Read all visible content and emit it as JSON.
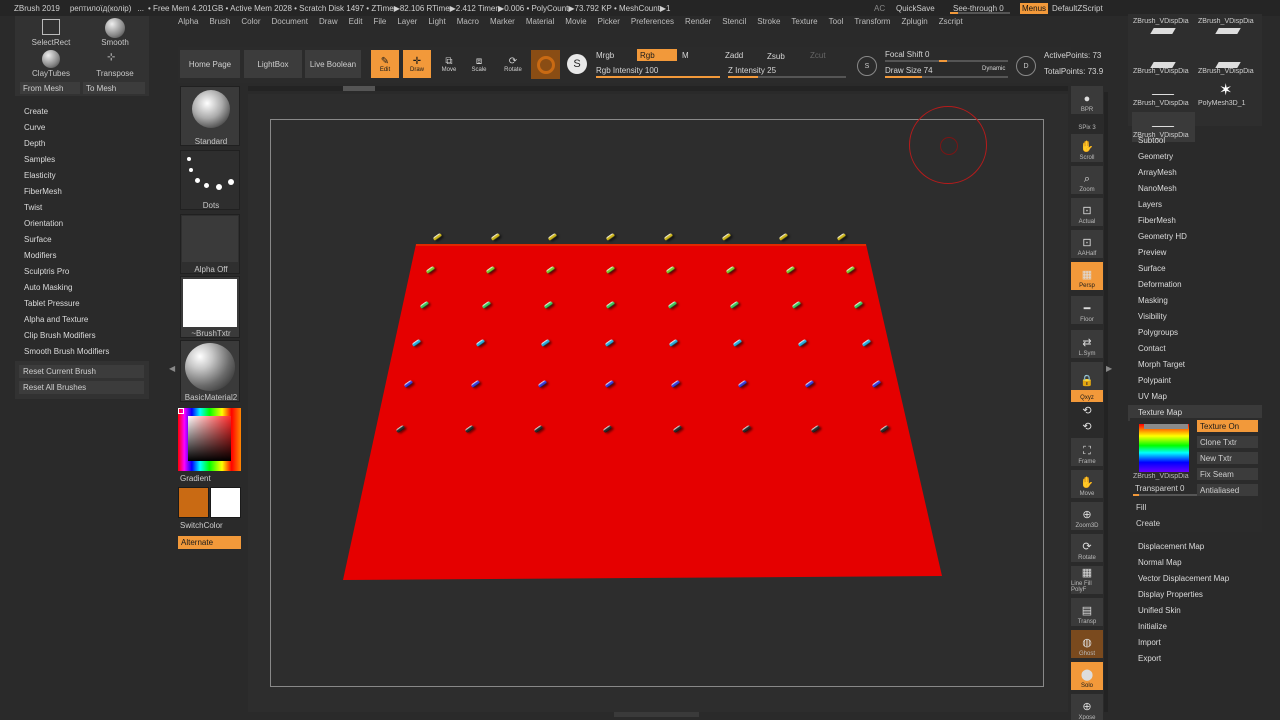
{
  "topbar": {
    "app": "ZBrush 2019",
    "doc": "рептилоїд(колір)",
    "sep": "...",
    "stats": "• Free Mem 4.201GB • Active Mem 2028 • Scratch Disk 1497 • ZTime▶82.106 RTime▶2.412 Timer▶0.006 • PolyCount▶73.792 KP • MeshCount▶1",
    "ac": "AC",
    "quicksave": "QuickSave",
    "seethrough": "See-through  0",
    "menus": "Menus",
    "script": "DefaultZScript"
  },
  "menubar": [
    "Alpha",
    "Brush",
    "Color",
    "Document",
    "Draw",
    "Edit",
    "File",
    "Layer",
    "Light",
    "Macro",
    "Marker",
    "Material",
    "Movie",
    "Picker",
    "Preferences",
    "Render",
    "Stencil",
    "Stroke",
    "Texture",
    "Tool",
    "Transform",
    "Zplugin",
    "Zscript"
  ],
  "left_palette": {
    "select_rect": "SelectRect",
    "smooth": "Smooth",
    "clay_tubes": "ClayTubes",
    "transpose": "Transpose",
    "from_mesh": "From Mesh",
    "to_mesh": "To Mesh",
    "items": [
      "Create",
      "Curve",
      "Depth",
      "Samples",
      "Elasticity",
      "FiberMesh",
      "Twist",
      "Orientation",
      "Surface",
      "Modifiers",
      "Sculptris Pro",
      "Auto Masking",
      "Tablet Pressure",
      "Alpha and Texture",
      "Clip Brush Modifiers",
      "Smooth Brush Modifiers"
    ],
    "reset_current": "Reset Current Brush",
    "reset_all": "Reset All Brushes"
  },
  "shelf": {
    "standard": "Standard",
    "dots": "Dots",
    "alpha_off": "Alpha Off",
    "brush_txtr": "~BrushTxtr",
    "material": "BasicMaterial2",
    "gradient": "Gradient",
    "switch_color": "SwitchColor",
    "alternate": "Alternate"
  },
  "toolbar": {
    "home": "Home Page",
    "lightbox": "LightBox",
    "live_boolean": "Live Boolean",
    "edit": "Edit",
    "draw": "Draw",
    "move": "Move",
    "scale": "Scale",
    "rotate": "Rotate",
    "mrgb": "Mrgb",
    "rgb": "Rgb",
    "m": "M",
    "rgb_intensity": "Rgb Intensity 100",
    "zadd": "Zadd",
    "zsub": "Zsub",
    "zcut": "Zcut",
    "z_intensity": "Z Intensity 25",
    "focal_shift": "Focal Shift 0",
    "draw_size": "Draw Size 74",
    "dynamic": "Dynamic",
    "active_points": "ActivePoints: 73",
    "total_points": "TotalPoints: 73.9"
  },
  "right_tools": [
    "BPR",
    "SPix 3",
    "Scroll",
    "Zoom",
    "Actual",
    "AAHalf",
    "Persp",
    "Floor",
    "L.Sym",
    "",
    "Qxyz",
    "",
    "",
    "Frame",
    "Move",
    "Zoom3D",
    "Rotate",
    "Line Fill PolyF",
    "Transp",
    "Ghost",
    "Solo",
    "Xpose"
  ],
  "subtools": [
    "ZBrush_VDispDia",
    "ZBrush_VDispDia",
    "ZBrush_VDispDia",
    "ZBrush_VDispDia",
    "ZBrush_VDispDia",
    "PolyMesh3D_1",
    "ZBrush_VDispDia"
  ],
  "right_menu_top": [
    "Subtool",
    "Geometry",
    "ArrayMesh",
    "NanoMesh",
    "Layers",
    "FiberMesh",
    "Geometry HD",
    "Preview",
    "Surface",
    "Deformation",
    "Masking",
    "Visibility",
    "Polygroups",
    "Contact",
    "Morph Target",
    "Polypaint",
    "UV Map",
    "Texture Map"
  ],
  "texture_map": {
    "texture_on": "Texture On",
    "clone_txtr": "Clone Txtr",
    "new_txtr": "New Txtr",
    "fix_seam": "Fix Seam",
    "antialiased": "Antialiased",
    "tex_name": "ZBrush_VDispDia",
    "transparent": "Transparent 0",
    "fill": "Fill",
    "create": "Create"
  },
  "right_menu_bottom": [
    "Displacement Map",
    "Normal Map",
    "Vector Displacement Map",
    "Display Properties",
    "Unified Skin",
    "Initialize",
    "Import",
    "Export"
  ],
  "colors": {
    "accent": "#f2993a",
    "canvas_bg": "#2d2d2d",
    "plane": "#e50000",
    "primary_color": "#c96a13",
    "secondary_color": "#ffffff"
  },
  "pin_rows": [
    {
      "color": "#c9b31a"
    },
    {
      "color": "#7fc22a"
    },
    {
      "color": "#3fc25a"
    },
    {
      "color": "#2aa8d8"
    },
    {
      "color": "#3a3ad8"
    },
    {
      "color": "#2b2b2b"
    }
  ]
}
